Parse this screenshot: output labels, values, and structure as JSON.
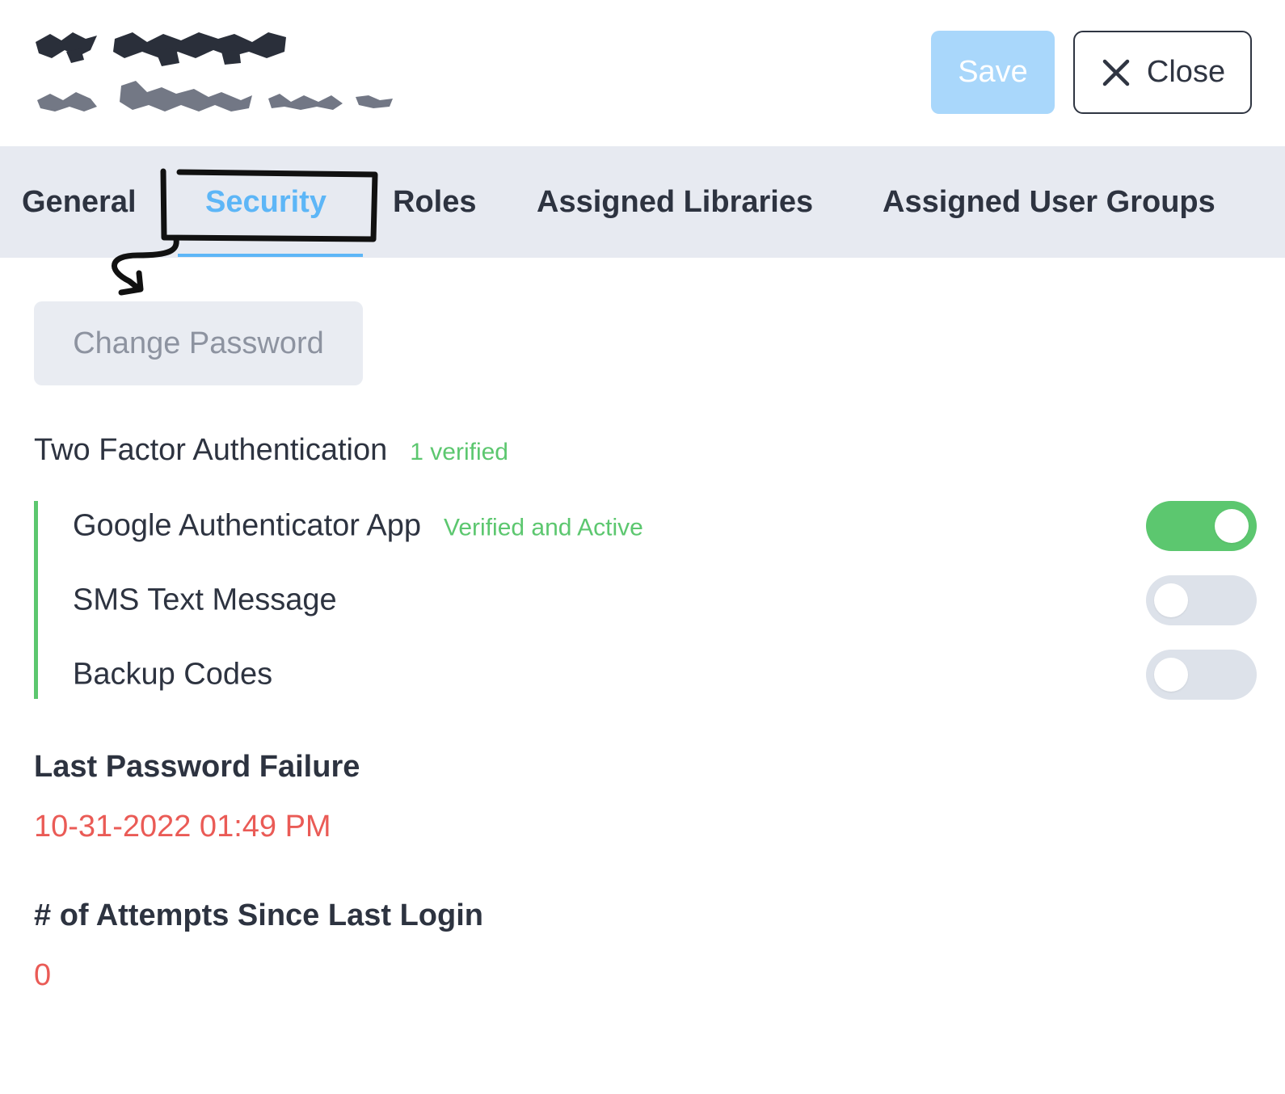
{
  "header": {
    "save_label": "Save",
    "close_label": "Close"
  },
  "tabs": [
    {
      "label": "General",
      "active": false
    },
    {
      "label": "Security",
      "active": true
    },
    {
      "label": "Roles",
      "active": false
    },
    {
      "label": "Assigned Libraries",
      "active": false
    },
    {
      "label": "Assigned User Groups",
      "active": false
    }
  ],
  "security": {
    "change_password_label": "Change Password",
    "two_factor": {
      "title": "Two Factor Authentication",
      "badge": "1 verified",
      "methods": [
        {
          "label": "Google Authenticator App",
          "status": "Verified and Active",
          "enabled": true
        },
        {
          "label": "SMS Text Message",
          "status": "",
          "enabled": false
        },
        {
          "label": "Backup Codes",
          "status": "",
          "enabled": false
        }
      ]
    },
    "last_failure": {
      "label": "Last Password Failure",
      "value": "10-31-2022 01:49 PM"
    },
    "attempts": {
      "label": "# of Attempts Since Last Login",
      "value": "0"
    }
  },
  "colors": {
    "accent": "#5db6f7",
    "success": "#5cc76f",
    "danger": "#ea5b56",
    "tab_bar": "#e7eaf1"
  },
  "icons": {
    "close": "close-icon",
    "annotation_arrow": "annotation-arrow-icon"
  }
}
